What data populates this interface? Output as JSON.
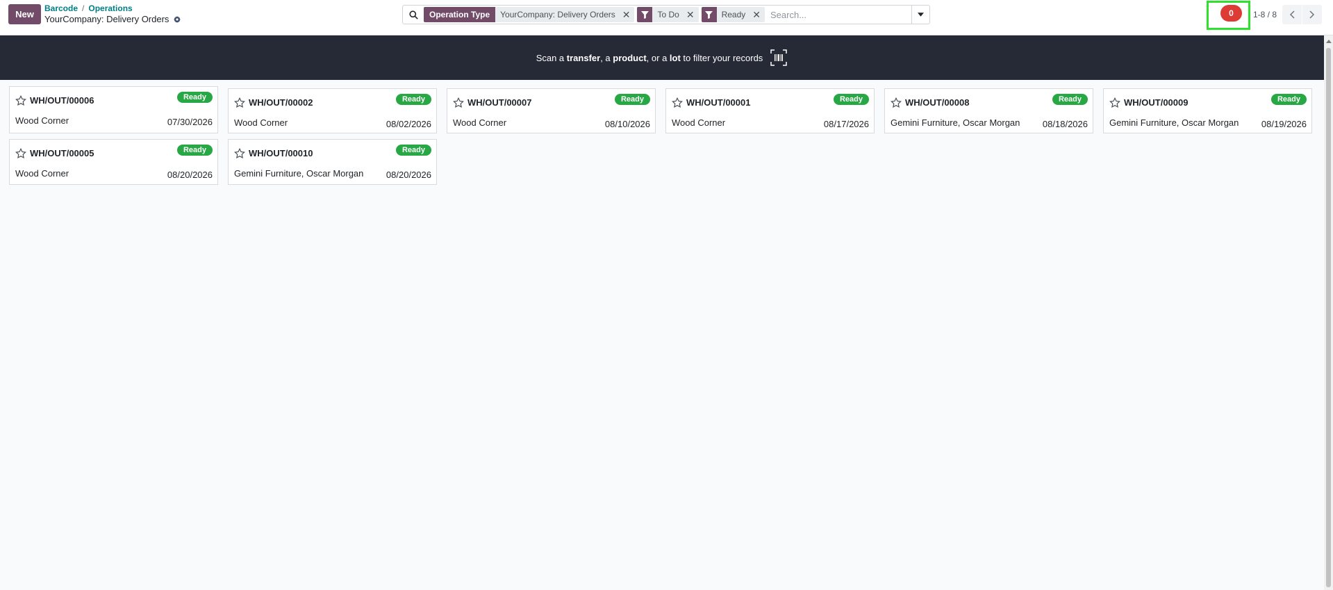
{
  "header": {
    "new_label": "New",
    "breadcrumb": [
      "Barcode",
      "Operations"
    ],
    "breadcrumb_separator": "/",
    "title": "YourCompany: Delivery Orders"
  },
  "search": {
    "facets": [
      {
        "type": "group",
        "label": "Operation Type",
        "value": "YourCompany: Delivery Orders"
      },
      {
        "type": "filter",
        "icon": "filter-icon",
        "value": "To Do"
      },
      {
        "type": "filter",
        "icon": "filter-icon",
        "value": "Ready"
      }
    ],
    "placeholder": "Search..."
  },
  "activity": {
    "count": "0"
  },
  "pager": {
    "value": "1-8 / 8"
  },
  "banner": {
    "t1": "Scan a ",
    "b1": "transfer",
    "t2": ", a ",
    "b2": "product",
    "t3": ", or a ",
    "b3": "lot",
    "t4": " to filter your records"
  },
  "colors": {
    "primary": "#714b67",
    "ready_badge": "#28a745",
    "banner_bg": "#262a36",
    "activity_badge": "#dc3c33",
    "highlight": "#2fe02f"
  },
  "cards": [
    {
      "name": "WH/OUT/00006",
      "status": "Ready",
      "partner": "Wood Corner",
      "date": "07/30/2026"
    },
    {
      "name": "WH/OUT/00002",
      "status": "Ready",
      "partner": "Wood Corner",
      "date": "08/02/2026"
    },
    {
      "name": "WH/OUT/00007",
      "status": "Ready",
      "partner": "Wood Corner",
      "date": "08/10/2026"
    },
    {
      "name": "WH/OUT/00001",
      "status": "Ready",
      "partner": "Wood Corner",
      "date": "08/17/2026"
    },
    {
      "name": "WH/OUT/00008",
      "status": "Ready",
      "partner": "Gemini Furniture, Oscar Morgan",
      "date": "08/18/2026"
    },
    {
      "name": "WH/OUT/00009",
      "status": "Ready",
      "partner": "Gemini Furniture, Oscar Morgan",
      "date": "08/19/2026"
    },
    {
      "name": "WH/OUT/00005",
      "status": "Ready",
      "partner": "Wood Corner",
      "date": "08/20/2026"
    },
    {
      "name": "WH/OUT/00010",
      "status": "Ready",
      "partner": "Gemini Furniture, Oscar Morgan",
      "date": "08/20/2026"
    }
  ]
}
